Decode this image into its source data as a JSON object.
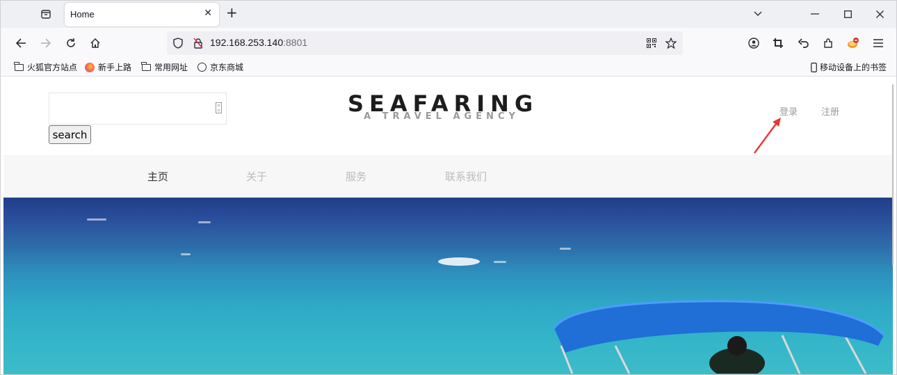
{
  "browser": {
    "tab": {
      "title": "Home"
    },
    "url": {
      "host": "192.168.253.140",
      "port": ":8801"
    },
    "bookmarks": [
      {
        "label": "火狐官方站点",
        "icon": "folder-icon"
      },
      {
        "label": "新手上路",
        "icon": "firefox-icon"
      },
      {
        "label": "常用网址",
        "icon": "folder-icon"
      },
      {
        "label": "京东商城",
        "icon": "globe-icon"
      }
    ],
    "mobile_bookmarks": "移动设备上的书签"
  },
  "site": {
    "search": {
      "value": "",
      "button": "search"
    },
    "logo": {
      "title": "SEAFARING",
      "subtitle": "A TRAVEL AGENCY"
    },
    "auth": {
      "login": "登录",
      "register": "注册"
    },
    "menu": [
      {
        "label": "主页",
        "active": true
      },
      {
        "label": "关于",
        "active": false
      },
      {
        "label": "服务",
        "active": false
      },
      {
        "label": "联系我们",
        "active": false
      }
    ]
  },
  "colors": {
    "annotation_arrow": "#e8372f",
    "canopy": "#1f6fd6",
    "menu_bg": "#f7f7f7"
  }
}
